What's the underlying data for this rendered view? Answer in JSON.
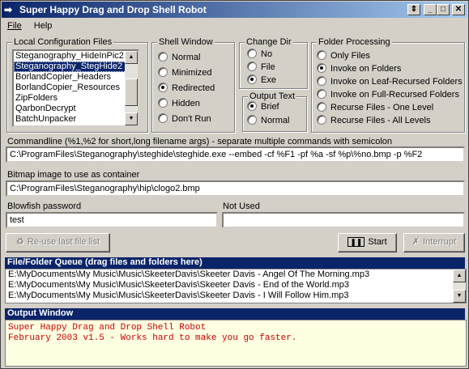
{
  "window": {
    "title": "Super Happy Drag and Drop Shell Robot"
  },
  "menu": {
    "file": "File",
    "help": "Help"
  },
  "local_config": {
    "title": "Local Configuration Files",
    "items": [
      {
        "label": "Steganography_HideInPic2",
        "selected": false
      },
      {
        "label": "Steganography_StegHide2",
        "selected": true
      },
      {
        "label": "BorlandCopier_Headers",
        "selected": false
      },
      {
        "label": "BorlandCopier_Resources",
        "selected": false
      },
      {
        "label": "ZipFolders",
        "selected": false
      },
      {
        "label": "QarbonDecrypt",
        "selected": false
      },
      {
        "label": "BatchUnpacker",
        "selected": false
      }
    ]
  },
  "shell_window": {
    "title": "Shell Window",
    "options": [
      {
        "label": "Normal",
        "selected": false
      },
      {
        "label": "Minimized",
        "selected": false
      },
      {
        "label": "Redirected",
        "selected": true
      },
      {
        "label": "Hidden",
        "selected": false
      },
      {
        "label": "Don't Run",
        "selected": false
      }
    ]
  },
  "change_dir": {
    "title": "Change Dir",
    "options": [
      {
        "label": "No",
        "selected": false
      },
      {
        "label": "File",
        "selected": false
      },
      {
        "label": "Exe",
        "selected": true
      }
    ]
  },
  "output_text": {
    "title": "Output Text",
    "options": [
      {
        "label": "Brief",
        "selected": true
      },
      {
        "label": "Normal",
        "selected": false
      }
    ]
  },
  "folder_processing": {
    "title": "Folder Processing",
    "options": [
      {
        "label": "Only Files",
        "selected": false
      },
      {
        "label": "Invoke on Folders",
        "selected": true
      },
      {
        "label": "Invoke on Leaf-Recursed Folders",
        "selected": false
      },
      {
        "label": "Invoke on Full-Recursed Folders",
        "selected": false
      },
      {
        "label": "Recurse Files - One Level",
        "selected": false
      },
      {
        "label": "Recurse Files - All Levels",
        "selected": false
      }
    ]
  },
  "commandline": {
    "label": "Commandline (%1,%2 for short,long filename args) - separate multiple commands with semicolon",
    "value": "C:\\ProgramFiles\\Steganography\\steghide\\steghide.exe --embed -cf %F1 -pf %a -sf %p\\%no.bmp -p %F2"
  },
  "bitmap": {
    "label": "Bitmap image to use as container",
    "value": "C:\\ProgramFiles\\Steganography\\hip\\clogo2.bmp"
  },
  "blowfish": {
    "label": "Blowfish password",
    "value": "test"
  },
  "not_used": {
    "label": "Not Used",
    "value": ""
  },
  "buttons": {
    "reuse": "Re-use last file list",
    "start": "Start",
    "interrupt": "Interrupt"
  },
  "queue": {
    "title": "File/Folder Queue (drag files and folders here)",
    "items": [
      "E:\\MyDocuments\\My Music\\Music\\SkeeterDavis\\Skeeter Davis - Angel Of The Morning.mp3",
      "E:\\MyDocuments\\My Music\\Music\\SkeeterDavis\\Skeeter Davis - End of the World.mp3",
      "E:\\MyDocuments\\My Music\\Music\\SkeeterDavis\\Skeeter Davis - I Will Follow Him.mp3"
    ]
  },
  "output": {
    "title": "Output Window",
    "lines": [
      "Super Happy Drag and Drop Shell Robot",
      "February 2003 v1.5 - Works hard to make you go faster."
    ]
  },
  "colors": {
    "titlebar": "#0a246a",
    "output_text": "#cc0000",
    "output_bg": "#ffffe1"
  }
}
